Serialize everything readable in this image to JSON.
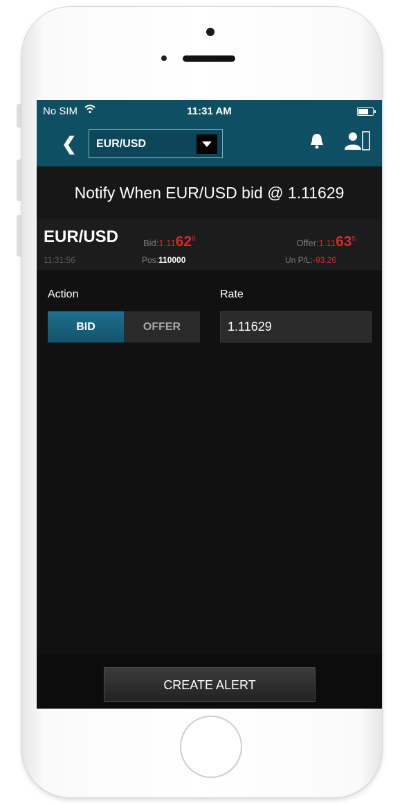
{
  "status_bar": {
    "carrier": "No SIM",
    "wifi_icon": "wifi-icon",
    "time": "11:31 AM"
  },
  "nav": {
    "back_icon": "chevron-left-icon",
    "symbol_value": "EUR/USD",
    "alerts_icon": "bell-icon",
    "account_icon": "account-icon"
  },
  "notify_text": "Notify When EUR/USD bid @ 1.11629",
  "quote": {
    "symbol": "EUR/USD",
    "time": "11:31:56",
    "bid_label": "Bid:",
    "bid_prefix": "1.11",
    "bid_big": "62",
    "bid_pip": "8",
    "offer_label": "Offer:",
    "offer_prefix": "1.11",
    "offer_big": "63",
    "offer_pip": "5",
    "pos_label": "Pos:",
    "pos_value": "110000",
    "pl_label": "Un P/L:",
    "pl_value": "-93.26"
  },
  "form": {
    "action_label": "Action",
    "rate_label": "Rate",
    "bid_option": "BID",
    "offer_option": "OFFER",
    "selected_action": "BID",
    "rate_value": "1.11629"
  },
  "create_button": "CREATE ALERT",
  "colors": {
    "header": "#0f4f63",
    "accent": "#1e6f8d",
    "negative": "#d42b2b"
  }
}
